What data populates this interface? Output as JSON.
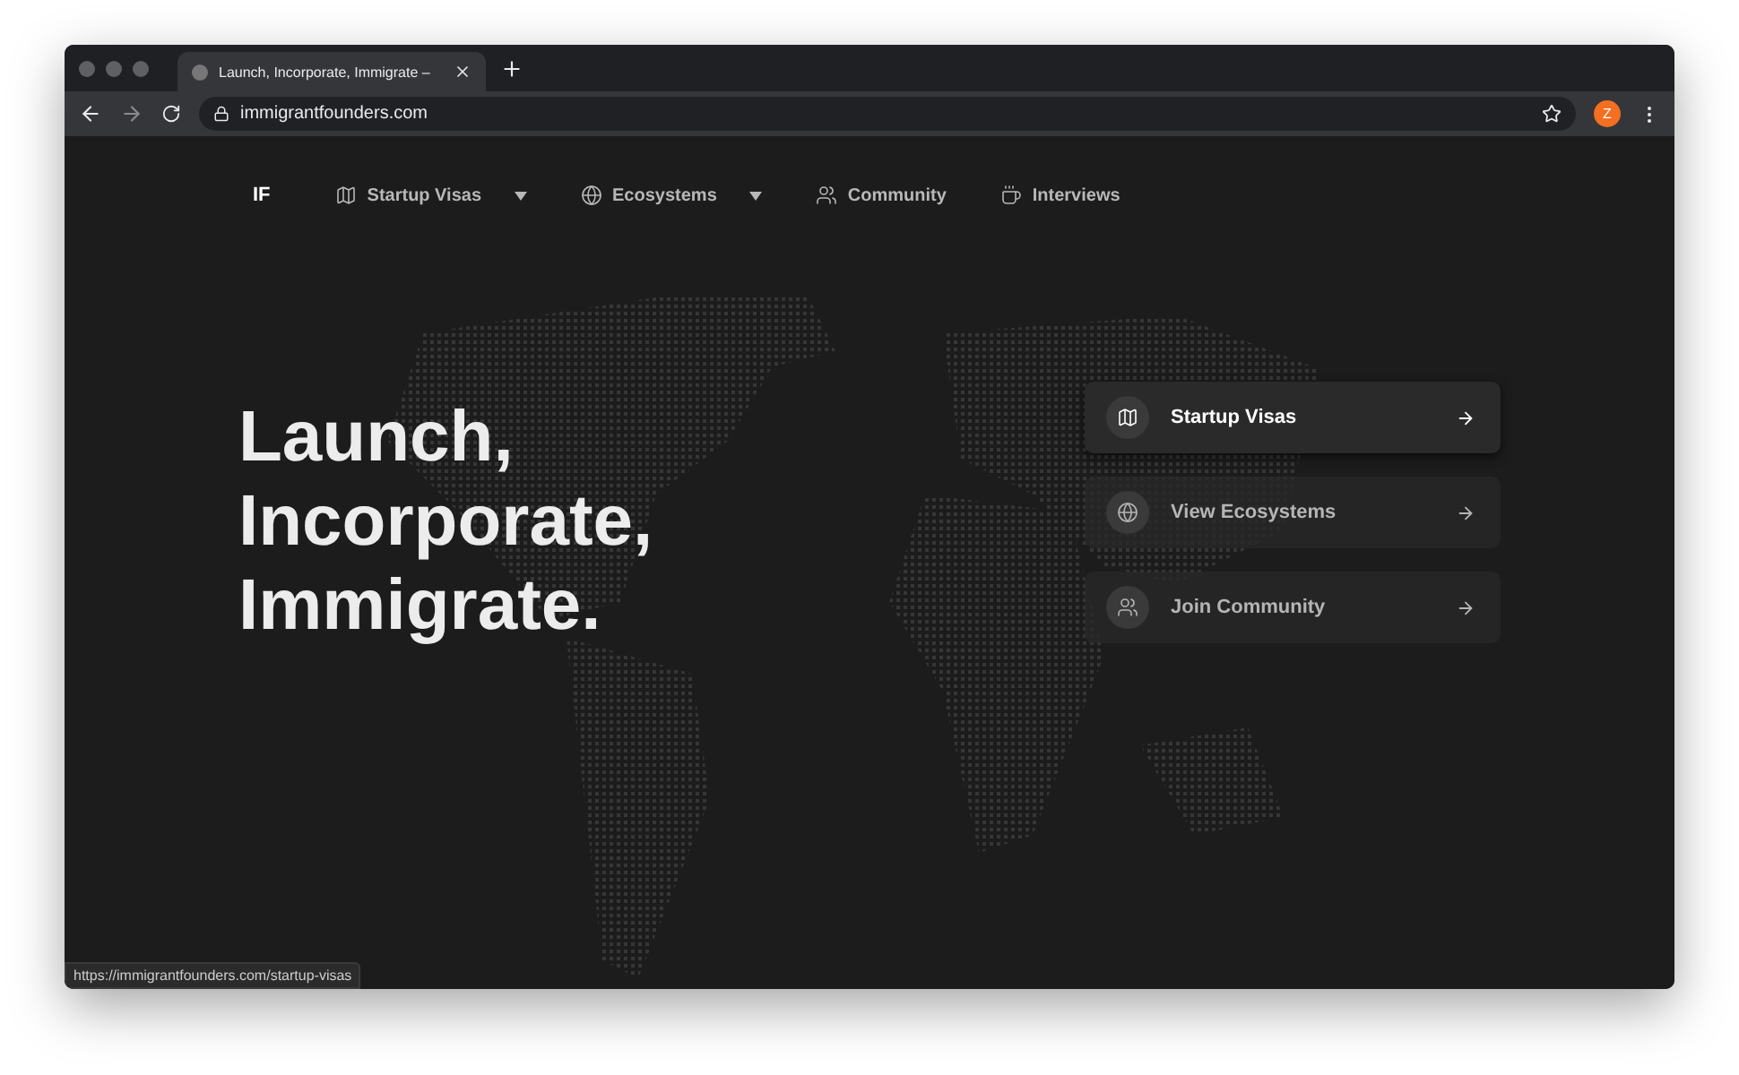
{
  "browser": {
    "tab_title": "Launch, Incorporate, Immigrate –",
    "url": "immigrantfounders.com",
    "profile_initial": "Z",
    "status_url": "https://immigrantfounders.com/startup-visas"
  },
  "nav": {
    "logo": "IF",
    "items": [
      {
        "label": "Startup Visas",
        "kind": "map",
        "has_dropdown": true
      },
      {
        "label": "Ecosystems",
        "kind": "globe",
        "has_dropdown": true
      },
      {
        "label": "Community",
        "kind": "users",
        "has_dropdown": false
      },
      {
        "label": "Interviews",
        "kind": "coffee",
        "has_dropdown": false
      }
    ]
  },
  "hero": {
    "title_lines": [
      "Launch,",
      "Incorporate,",
      "Immigrate."
    ]
  },
  "actions": [
    {
      "label": "Startup Visas",
      "kind": "map",
      "selected": true
    },
    {
      "label": "View Ecosystems",
      "kind": "globe",
      "selected": false
    },
    {
      "label": "Join Community",
      "kind": "users",
      "selected": false
    }
  ]
}
